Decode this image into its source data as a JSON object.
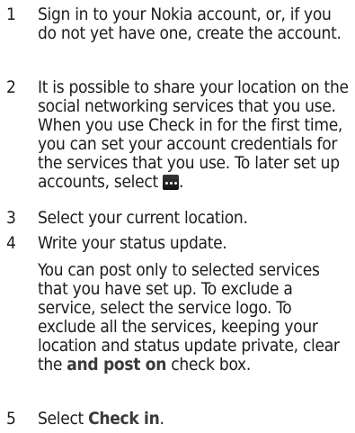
{
  "steps": [
    {
      "number": "1",
      "text": "Sign in to your Nokia account, or, if you do not yet have one, create the account."
    },
    {
      "number": "2",
      "text": "It is possible to share your location on the social networking services that you use. When you use Check in for the first time, you can set your account credentials for the services that you use. To later set up accounts, select",
      "icon": "more-options-icon",
      "after": "."
    },
    {
      "number": "3",
      "text": "Select your current location."
    },
    {
      "number": "4",
      "text": "Write your status update."
    },
    {
      "number": "5",
      "prefix": "Select ",
      "bold": "Check in",
      "suffix": "."
    }
  ],
  "note": {
    "before": "You can post only to selected services that you have set up. To exclude a service, select the service logo. To exclude all the services, keeping your location and status update private, clear the ",
    "bold": "and post on",
    "after": " check box."
  }
}
